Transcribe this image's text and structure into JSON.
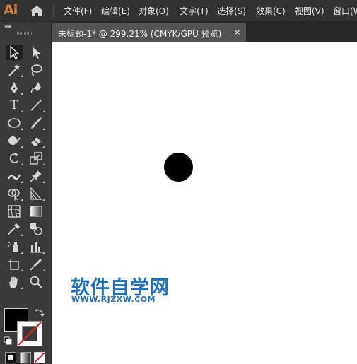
{
  "app": {
    "logo": "Ai"
  },
  "menu": {
    "items": [
      "文件(F)",
      "编辑(E)",
      "对象(O)",
      "文字(T)",
      "选择(S)",
      "效果(C)",
      "视图(V)",
      "窗口(W"
    ]
  },
  "toolbar": {
    "collapse_label": "◂◂",
    "type_tool_glyph": "T",
    "fill_color": "#000000",
    "stroke_color": "none"
  },
  "document": {
    "tab_title": "未标题-1* @ 299.21% (CMYK/GPU 预览)",
    "close_glyph": "×"
  },
  "canvas": {
    "shape_color": "#000000"
  },
  "watermark": {
    "title": "软件自学网",
    "url": "WWW.RJZXW.COM",
    "color": "#1f6fc4"
  },
  "colors": {
    "accent": "#d8823c",
    "panel": "#3a3a3a",
    "menubar": "#323232"
  }
}
